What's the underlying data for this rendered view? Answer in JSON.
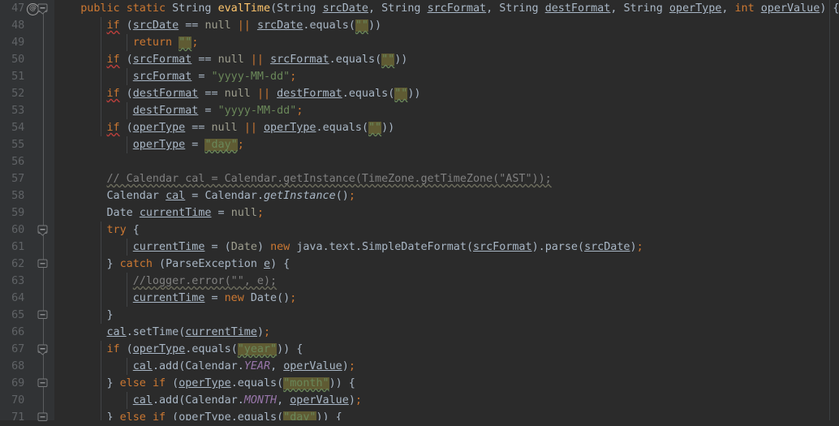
{
  "editor": {
    "theme": "darcula",
    "language": "java",
    "background": "#2b2b2b",
    "gutter_background": "#313335",
    "first_line": 47,
    "last_line": 71,
    "colors": {
      "keyword": "#cc7832",
      "string": "#6a8759",
      "comment": "#808080",
      "method_declaration": "#ffc66d",
      "static_constant": "#9876aa",
      "default_text": "#a9b7c6",
      "greyed": "#9e9e8e",
      "line_number": "#606366",
      "highlight_background": "#5f5b33",
      "error_squiggle": "#bc3f3c",
      "typo_squiggle": "#6a8759"
    }
  },
  "gutter": {
    "icons": [
      {
        "line": 47,
        "name": "override-method-icon",
        "glyph": "@",
        "tooltip": "Overrides method"
      }
    ],
    "fold_markers": [
      {
        "line": 47,
        "state": "expanded",
        "shape": "top"
      },
      {
        "line": 60,
        "state": "expanded",
        "shape": "top"
      },
      {
        "line": 62,
        "state": "expanded",
        "shape": "middle"
      },
      {
        "line": 65,
        "state": "expanded",
        "shape": "bottom"
      },
      {
        "line": 67,
        "state": "expanded",
        "shape": "top"
      },
      {
        "line": 69,
        "state": "expanded",
        "shape": "middle"
      },
      {
        "line": 71,
        "state": "expanded",
        "shape": "middle"
      }
    ]
  },
  "lines": [
    {
      "n": 47,
      "text": "    public static String evalTime(String srcDate, String srcFormat, String destFormat, String operType, int operValue) {"
    },
    {
      "n": 48,
      "text": "        if (srcDate == null || srcDate.equals(\"\"))"
    },
    {
      "n": 49,
      "text": "            return \"\";"
    },
    {
      "n": 50,
      "text": "        if (srcFormat == null || srcFormat.equals(\"\"))"
    },
    {
      "n": 51,
      "text": "            srcFormat = \"yyyy-MM-dd\";"
    },
    {
      "n": 52,
      "text": "        if (destFormat == null || destFormat.equals(\"\"))"
    },
    {
      "n": 53,
      "text": "            destFormat = \"yyyy-MM-dd\";"
    },
    {
      "n": 54,
      "text": "        if (operType == null || operType.equals(\"\"))"
    },
    {
      "n": 55,
      "text": "            operType = \"day\";"
    },
    {
      "n": 56,
      "text": ""
    },
    {
      "n": 57,
      "text": "        // Calendar cal = Calendar.getInstance(TimeZone.getTimeZone(\"AST\"));"
    },
    {
      "n": 58,
      "text": "        Calendar cal = Calendar.getInstance();"
    },
    {
      "n": 59,
      "text": "        Date currentTime = null;"
    },
    {
      "n": 60,
      "text": "        try {"
    },
    {
      "n": 61,
      "text": "            currentTime = (Date) new java.text.SimpleDateFormat(srcFormat).parse(srcDate);"
    },
    {
      "n": 62,
      "text": "        } catch (ParseException e) {"
    },
    {
      "n": 63,
      "text": "            //logger.error(\"\", e);"
    },
    {
      "n": 64,
      "text": "            currentTime = new Date();"
    },
    {
      "n": 65,
      "text": "        }"
    },
    {
      "n": 66,
      "text": "        cal.setTime(currentTime);"
    },
    {
      "n": 67,
      "text": "        if (operType.equals(\"year\")) {"
    },
    {
      "n": 68,
      "text": "            cal.add(Calendar.YEAR, operValue);"
    },
    {
      "n": 69,
      "text": "        } else if (operType.equals(\"month\")) {"
    },
    {
      "n": 70,
      "text": "            cal.add(Calendar.MONTH, operValue);"
    },
    {
      "n": 71,
      "text": "        } else if (operType.equals(\"day\")) {"
    }
  ],
  "method_signature": {
    "modifiers": "public static",
    "return_type": "String",
    "name": "evalTime",
    "parameters": [
      {
        "type": "String",
        "name": "srcDate"
      },
      {
        "type": "String",
        "name": "srcFormat"
      },
      {
        "type": "String",
        "name": "destFormat"
      },
      {
        "type": "String",
        "name": "operType"
      },
      {
        "type": "int",
        "name": "operValue"
      }
    ]
  },
  "highlighted_literals": [
    "\"\"",
    "\"year\"",
    "\"month\"",
    "\"day\""
  ]
}
